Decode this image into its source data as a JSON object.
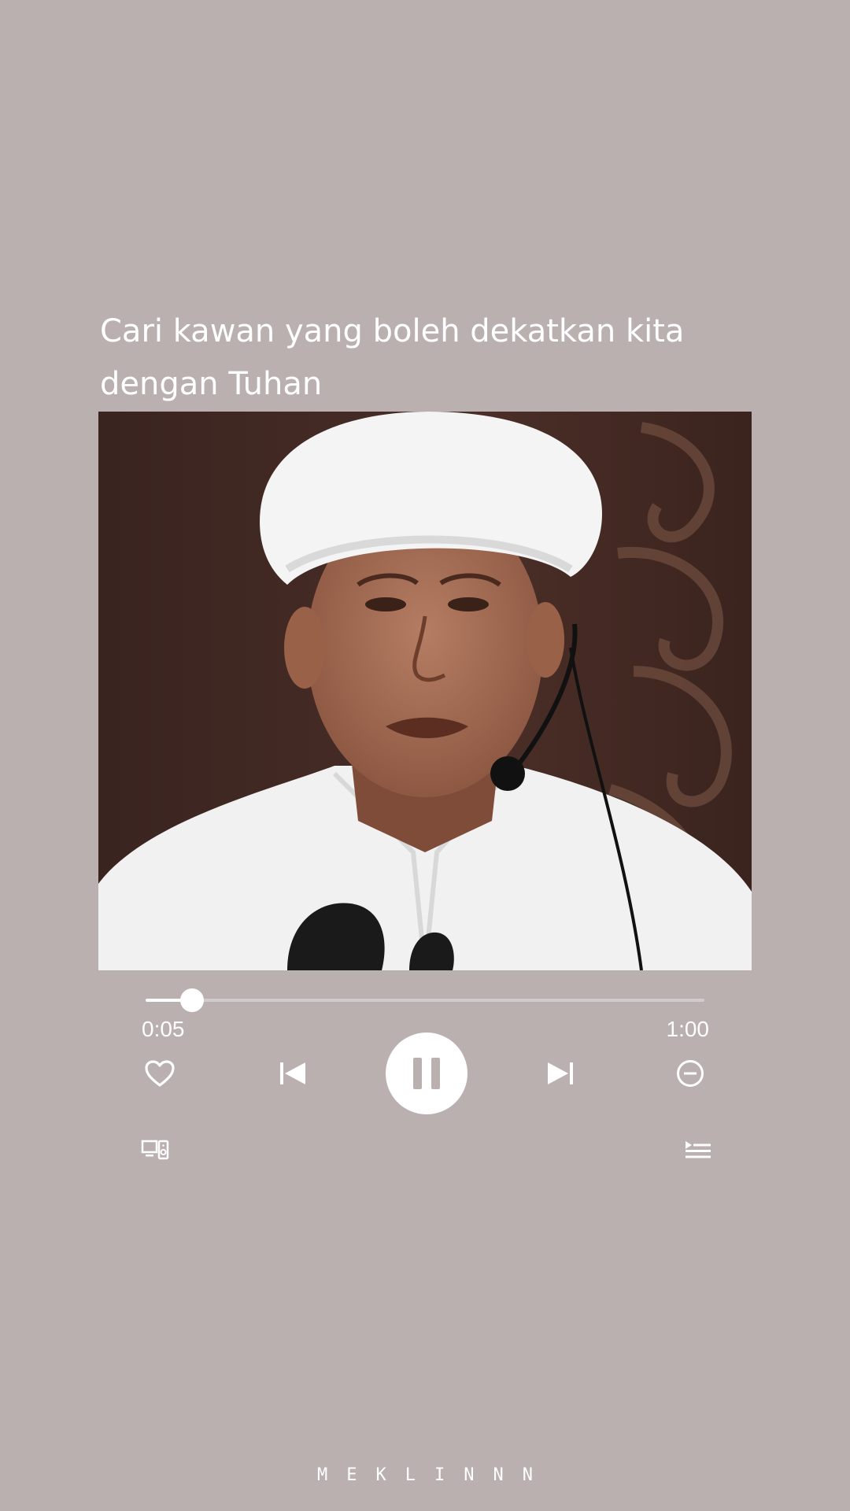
{
  "caption": {
    "line1": "Cari kawan yang boleh dekatkan kita",
    "line2": "dengan Tuhan"
  },
  "player": {
    "current_time": "0:05",
    "total_time": "1:00",
    "progress_fraction": 0.0833,
    "state": "playing"
  },
  "icons": {
    "like": "heart-icon",
    "previous": "skip-previous-icon",
    "play_pause": "pause-icon",
    "next": "skip-next-icon",
    "remove": "minus-circle-icon",
    "devices": "devices-icon",
    "queue": "queue-icon"
  },
  "footer": {
    "watermark": "MEKLINNN"
  },
  "colors": {
    "background": "#bab0b0",
    "foreground": "#ffffff"
  }
}
